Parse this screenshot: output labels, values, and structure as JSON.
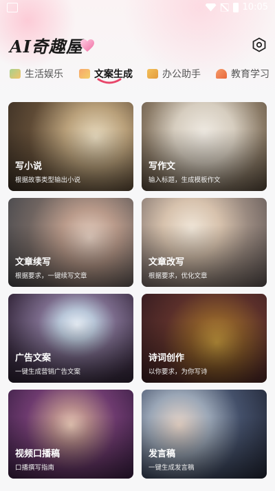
{
  "status_bar": {
    "time": "10:05"
  },
  "header": {
    "title": "AI奇趣屋"
  },
  "tabs": [
    {
      "label": "生活娱乐",
      "active": false
    },
    {
      "label": "文案生成",
      "active": true
    },
    {
      "label": "办公助手",
      "active": false
    },
    {
      "label": "教育学习",
      "active": false
    }
  ],
  "cards": [
    {
      "title": "写小说",
      "desc": "根据故事类型输出小说"
    },
    {
      "title": "写作文",
      "desc": "输入标题，生成模板作文"
    },
    {
      "title": "文章续写",
      "desc": "根据要求，一键续写文章"
    },
    {
      "title": "文章改写",
      "desc": "根据要求，优化文章"
    },
    {
      "title": "广告文案",
      "desc": "一键生成营销广告文案"
    },
    {
      "title": "诗词创作",
      "desc": "以你要求，为你写诗"
    },
    {
      "title": "视频口播稿",
      "desc": "口播撰写指南"
    },
    {
      "title": "发言稿",
      "desc": "一键生成发言稿"
    }
  ],
  "colors": {
    "accent": "#e8456a",
    "text": "#1a1a1a"
  }
}
